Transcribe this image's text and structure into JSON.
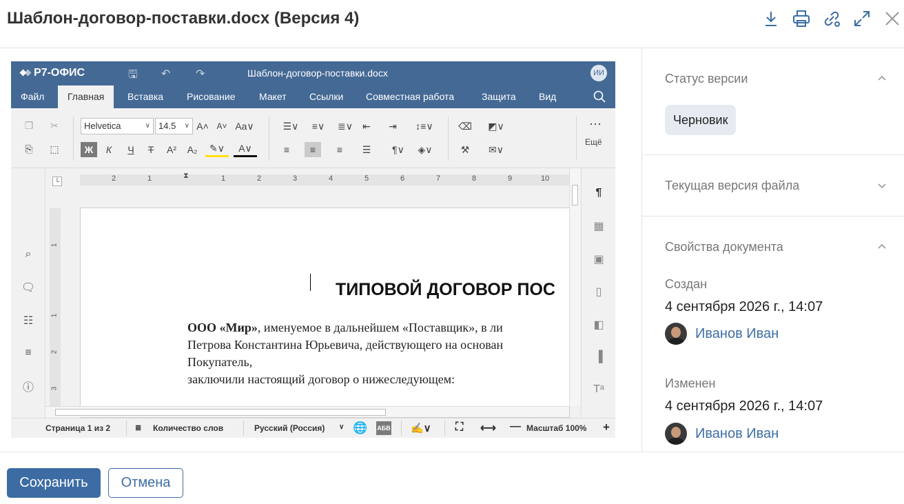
{
  "dialog": {
    "title": "Шаблон-договор-поставки.docx (Версия 4)",
    "icons": [
      "download-icon",
      "print-icon",
      "share-link-icon",
      "expand-icon",
      "close-icon"
    ]
  },
  "editor": {
    "brand": "Р7-ОФИС",
    "doc_name": "Шаблон-договор-поставки.docx",
    "user_initials": "ИИ",
    "accent": "#446995",
    "menu": [
      "Файл",
      "Главная",
      "Вставка",
      "Рисование",
      "Макет",
      "Ссылки",
      "Совместная работа",
      "Защита",
      "Вид"
    ],
    "active_menu": "Главная",
    "font_name": "Helvetica",
    "font_size": "14.5",
    "more_label": "Ещё",
    "ruler_numbers": [
      "2",
      "1",
      "1",
      "2",
      "3",
      "4",
      "5",
      "6",
      "7",
      "8",
      "9",
      "10"
    ],
    "vruler_numbers": [
      "1",
      "1",
      "2",
      "3"
    ],
    "page": {
      "heading": "ТИПОВОЙ ДОГОВОР ПОС",
      "line1_bold": "ООО «Мир»",
      "line1_rest": ", именуемое в дальнейшем «Поставщик», в ли",
      "line2": "Петрова Константина Юрьевича, действующего на основан",
      "line3": "Покупатель,",
      "line4": "заключили настоящий договор о нижеследующем:"
    },
    "status": {
      "page": "Страница 1 из 2",
      "word_count": "Количество слов",
      "language": "Русский (Россия)",
      "zoom": "Масштаб 100%"
    }
  },
  "sidebar": {
    "status_section": {
      "title": "Статус версии",
      "value": "Черновик"
    },
    "current_version_section": {
      "title": "Текущая версия файла"
    },
    "properties_section": {
      "title": "Свойства документа",
      "created_label": "Создан",
      "created_value": "4 сентября 2026 г., 14:07",
      "created_by": "Иванов Иван",
      "modified_label": "Изменен",
      "modified_value": "4 сентября 2026 г., 14:07",
      "modified_by": "Иванов Иван"
    }
  },
  "footer": {
    "save": "Сохранить",
    "cancel": "Отмена"
  }
}
